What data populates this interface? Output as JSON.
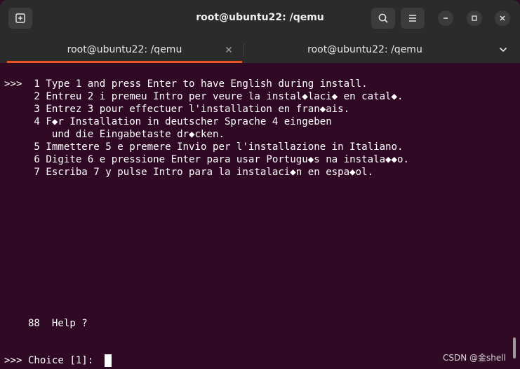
{
  "window": {
    "title": "root@ubuntu22: /qemu"
  },
  "tabs": [
    {
      "label": "root@ubuntu22: /qemu",
      "active": true
    },
    {
      "label": "root@ubuntu22: /qemu",
      "active": false
    }
  ],
  "icons": {
    "new_tab": "new-tab-icon",
    "search": "search-icon",
    "menu": "hamburger-menu-icon",
    "minimize": "minimize-icon",
    "maximize": "maximize-icon",
    "close": "close-icon",
    "tab_close": "close-icon",
    "tab_dropdown": "chevron-down-icon"
  },
  "colors": {
    "terminal_bg": "#300a24",
    "headerbar_bg": "#2b2b2b",
    "accent": "#e95420",
    "text": "#ffffff"
  },
  "terminal": {
    "lines": [
      ">>>  1 Type 1 and press Enter to have English during install.",
      "     2 Entreu 2 i premeu Intro per veure la instal◆laci◆ en catal◆.",
      "     3 Entrez 3 pour effectuer l'installation en fran◆ais.",
      "     4 F◆r Installation in deutscher Sprache 4 eingeben",
      "        und die Eingabetaste dr◆cken.",
      "     5 Immettere 5 e premere Invio per l'installazione in Italiano.",
      "     6 Digite 6 e pressione Enter para usar Portugu◆s na instala◆◆o.",
      "     7 Escriba 7 y pulse Intro para la instalaci◆n en espa◆ol."
    ],
    "help": "    88  Help ?",
    "prompt": ">>> Choice [1]: "
  },
  "watermark": "CSDN @金shell"
}
